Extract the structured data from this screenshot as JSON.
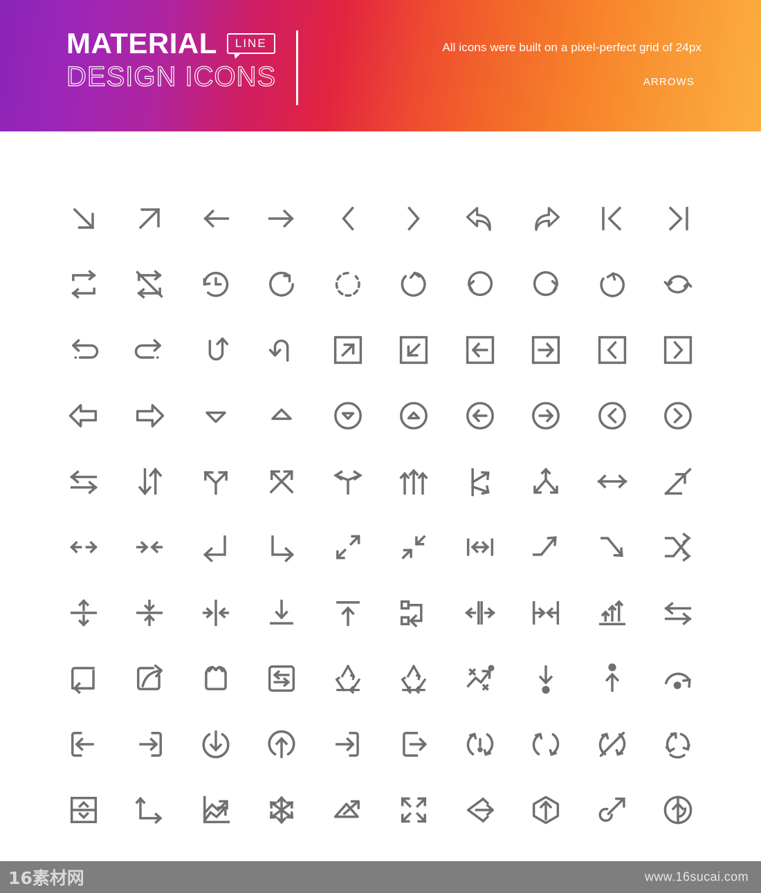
{
  "header": {
    "title_primary": "MATERIAL",
    "title_secondary": "DESIGN ICONS",
    "badge_label": "LINE",
    "tagline": "All icons were built on a pixel-perfect grid of 24px",
    "category": "ARROWS",
    "gradient_start": "#8b24b8",
    "gradient_mid": "#e2243f",
    "gradient_end": "#fbb040"
  },
  "grid": {
    "columns": 10,
    "rows": 10,
    "total_icons": 100,
    "icon_color": "#6f7070",
    "icons": [
      "arrow-down-right-icon",
      "arrow-up-right-icon",
      "arrow-left-icon",
      "arrow-right-icon",
      "chevron-left-icon",
      "chevron-right-icon",
      "reply-icon",
      "forward-icon",
      "skip-to-start-icon",
      "skip-to-end-icon",
      "repeat-icon",
      "repeat-off-icon",
      "history-clock-icon",
      "refresh-cw-icon",
      "rotate-dashed-icon",
      "rotate-cw-icon",
      "rotate-ccw-circle-icon",
      "rotate-cw-circle-icon",
      "undo-circle-icon",
      "sync-icon",
      "undo-icon",
      "redo-icon",
      "u-turn-up-icon",
      "u-turn-down-icon",
      "box-arrow-up-right-icon",
      "box-arrow-down-left-icon",
      "box-arrow-left-icon",
      "box-arrow-right-icon",
      "box-chevron-left-icon",
      "box-chevron-right-icon",
      "block-arrow-left-icon",
      "block-arrow-right-icon",
      "caret-down-icon",
      "caret-up-icon",
      "circle-caret-down-icon",
      "circle-caret-up-icon",
      "circle-arrow-left-icon",
      "circle-arrow-right-icon",
      "circle-chevron-left-icon",
      "circle-chevron-right-icon",
      "swap-horizontal-icon",
      "swap-vertical-icon",
      "fork-up-right-icon",
      "cross-arrows-icon",
      "split-left-right-icon",
      "three-arrows-up-icon",
      "branch-right-icon",
      "merge-three-icon",
      "arrows-left-right-icon",
      "diagonal-step-up-icon",
      "expand-horizontal-icon",
      "collapse-horizontal-icon",
      "return-enter-icon",
      "corner-down-right-icon",
      "expand-diagonal-icon",
      "collapse-diagonal-icon",
      "width-measure-icon",
      "trend-up-arrow-icon",
      "trend-down-arrow-icon",
      "shuffle-icon",
      "distribute-vertical-icon",
      "collapse-to-center-icon",
      "align-center-horizontal-icon",
      "align-bottom-icon",
      "align-top-icon",
      "flow-branch-icon",
      "expand-from-center-icon",
      "collapse-to-divider-icon",
      "bar-chart-up-icon",
      "transfer-icon",
      "box-loop-icon",
      "share-box-icon",
      "box-import-icon",
      "box-swap-icon",
      "recycle-icon",
      "recycle-alt-icon",
      "trend-scatter-icon",
      "download-dot-icon",
      "upload-dot-icon",
      "arc-redo-icon",
      "box-arrow-in-left-icon",
      "box-arrow-in-right-icon",
      "download-circle-icon",
      "upload-circle-icon",
      "sign-in-icon",
      "sign-out-icon",
      "sync-alert-icon",
      "sync-cw-icon",
      "sync-off-icon",
      "sync-circle-icon",
      "stepper-updown-icon",
      "corner-path-icon",
      "trending-chart-icon",
      "move-six-way-icon",
      "mountain-arrow-icon",
      "fullscreen-expand-icon",
      "diamond-arrow-icon",
      "hexagon-arrow-up-icon",
      "curve-arrow-up-right-icon",
      "circle-updown-icon"
    ]
  },
  "footer": {
    "brand": "16素材网",
    "url": "www.16sucai.com",
    "background": "#7e7e7e"
  }
}
